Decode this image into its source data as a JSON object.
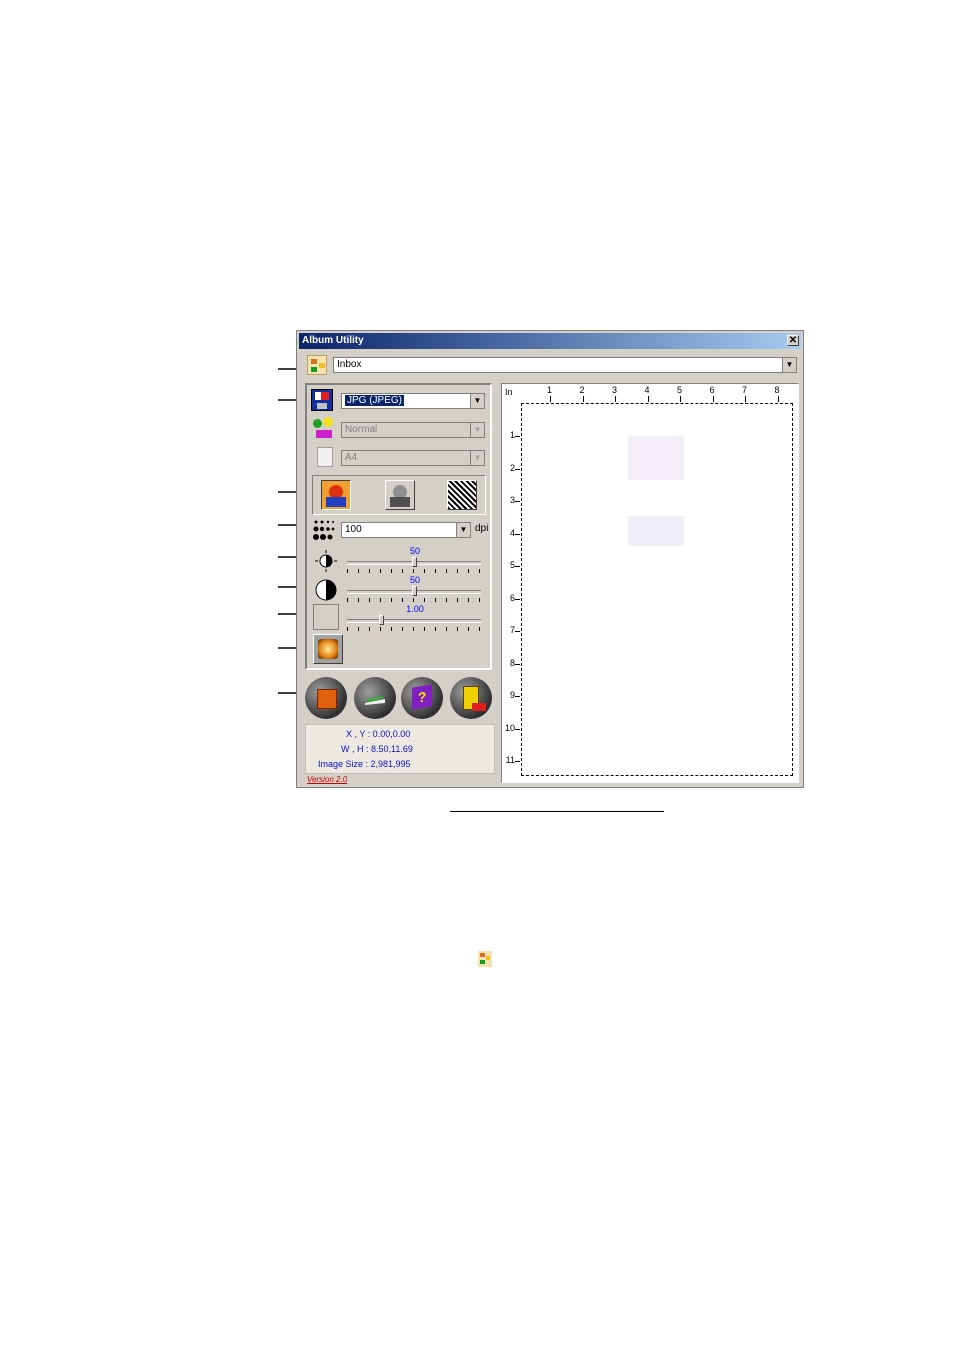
{
  "window": {
    "title": "Album Utility",
    "close_label": "✕"
  },
  "album_select": {
    "value": "Inbox"
  },
  "format_select": {
    "value": "JPG (JPEG)"
  },
  "quality_select": {
    "value": "Normal"
  },
  "paper_select": {
    "value": "A4"
  },
  "dpi_select": {
    "value": "100",
    "unit": "dpi"
  },
  "brightness": {
    "value": "50",
    "level": 0.5
  },
  "contrast": {
    "value": "50",
    "level": 0.5
  },
  "gamma": {
    "value": "1.00",
    "level": 0.25
  },
  "ruler": {
    "unit": "In",
    "top_ticks": [
      "1",
      "2",
      "3",
      "4",
      "5",
      "6",
      "7",
      "8"
    ],
    "left_ticks": [
      "1",
      "2",
      "3",
      "4",
      "5",
      "6",
      "7",
      "8",
      "9",
      "10",
      "11"
    ]
  },
  "info": {
    "xy": "X , Y : 0.00,0.00",
    "wh": "W , H : 8.50,11.69",
    "image_size": "Image Size : 2,981,995"
  },
  "version": "Version 2.0",
  "colors": {
    "titlebar_start": "#0a246a",
    "titlebar_end": "#a6caf0",
    "face": "#d4d0c8",
    "info_text": "#1010c0",
    "version_text": "#cc0000"
  },
  "icons": {
    "album": "album-icon",
    "format": "save-format-icon",
    "quality": "quality-icon",
    "paper": "paper-icon",
    "dpi": "dpi-dots-icon",
    "brightness": "brightness-icon",
    "contrast": "contrast-icon",
    "gamma": "gamma-grid-icon",
    "filter": "filter-icon",
    "buttons": [
      "acquire-icon",
      "scan-icon",
      "help-book-icon",
      "exit-icon"
    ]
  }
}
